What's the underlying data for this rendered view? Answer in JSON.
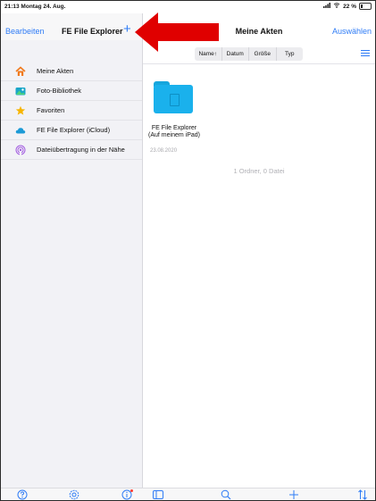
{
  "status_bar": {
    "time_date": "21:13 Montag 24. Aug.",
    "battery": "22 %",
    "battery_level": 0.22
  },
  "sidebar": {
    "edit_label": "Bearbeiten",
    "title": "FE File Explorer",
    "add_label": "+",
    "items": [
      {
        "label": "Meine Akten",
        "icon": "home-icon"
      },
      {
        "label": "Foto-Bibliothek",
        "icon": "photo-library-icon"
      },
      {
        "label": "Favoriten",
        "icon": "star-icon"
      },
      {
        "label": "FE File Explorer (iCloud)",
        "icon": "cloud-icon"
      },
      {
        "label": "Dateiübertragung in der Nähe",
        "icon": "airdrop-icon"
      }
    ]
  },
  "main": {
    "title": "Meine Akten",
    "select_label": "Auswählen",
    "sort_columns": [
      "Name↑",
      "Datum",
      "Größe",
      "Typ"
    ],
    "items": [
      {
        "name_line1": "FE File Explorer",
        "name_line2": "(Auf meinem iPad)",
        "date": "23.08.2020",
        "icon": "folder-icon"
      }
    ],
    "summary": "1 Ordner, 0 Datei"
  },
  "toolbar": {
    "left_icons": [
      "help-icon",
      "settings-icon",
      "info-icon"
    ],
    "right_icons": [
      "sidebar-toggle-icon",
      "search-icon",
      "add-icon",
      "sort-icon"
    ]
  },
  "colors": {
    "accent": "#2f7cf6",
    "folder": "#1ab1ec",
    "annotation_arrow": "#e00000"
  }
}
